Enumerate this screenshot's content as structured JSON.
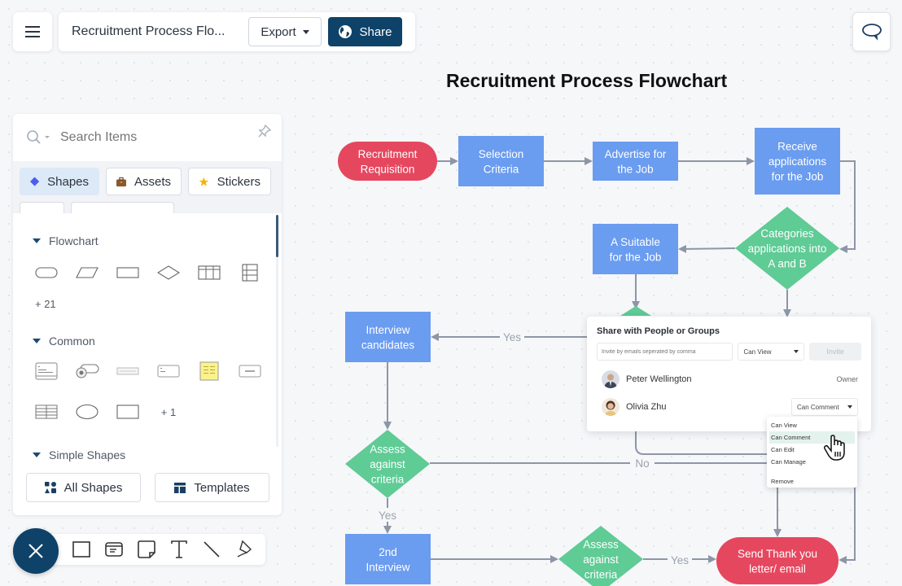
{
  "header": {
    "menu_icon": "hamburger-menu-icon",
    "document_title": "Recruitment Process Flo...",
    "export_label": "Export",
    "share_label": "Share",
    "share_icon": "globe-icon",
    "comment_icon": "speech-bubble-icon",
    "colors": {
      "share_button": "#0e4269"
    }
  },
  "panel": {
    "search_placeholder": "Search Items",
    "pin_icon": "pin-icon",
    "tabs": [
      {
        "label": "Shapes",
        "icon": "diamond-icon",
        "active": true
      },
      {
        "label": "Assets",
        "icon": "briefcase-icon",
        "active": false
      },
      {
        "label": "Stickers",
        "icon": "star-icon",
        "active": false
      }
    ],
    "sections": [
      {
        "title": "Flowchart",
        "more": "+ 21",
        "shapes": [
          "terminator",
          "data-parallelogram",
          "process-rectangle",
          "decision-diamond",
          "swimlane-horizontal",
          "swimlane-vertical"
        ]
      },
      {
        "title": "Common",
        "more": "+ 1",
        "shapes": [
          "form-card",
          "toggle-card",
          "slider-card",
          "input-card",
          "sticky-note",
          "dropdown-card",
          "table",
          "ellipse",
          "rectangle"
        ]
      },
      {
        "title": "Simple Shapes"
      }
    ],
    "all_shapes_label": "All Shapes",
    "templates_label": "Templates"
  },
  "toolbar": {
    "close_icon": "close-icon",
    "tools": [
      "rectangle-tool-icon",
      "text-card-tool-icon",
      "sticky-note-tool-icon",
      "text-tool-icon",
      "line-tool-icon",
      "pen-tool-icon"
    ]
  },
  "canvas": {
    "title": "Recruitment Process Flowchart",
    "colors": {
      "process": "#6a9cf0",
      "decision": "#5fcb95",
      "terminal": "#e5475f",
      "edge": "#8d96a6"
    },
    "nodes": {
      "requisition": [
        "Recruitment",
        "Requisition"
      ],
      "selection": [
        "Selection",
        "Criteria"
      ],
      "advertise": [
        "Advertise for",
        "the Job"
      ],
      "receive": [
        "Receive",
        "applications",
        "for the Job"
      ],
      "categorize": [
        "Categories",
        "applications into",
        "A and B"
      ],
      "suitable": [
        "A Suitable",
        "for the Job"
      ],
      "interview": [
        "Interview",
        "candidates"
      ],
      "assess1": [
        "Assess",
        "against",
        "criteria"
      ],
      "second": [
        "2nd",
        "Interview"
      ],
      "assess2": [
        "Assess",
        "against",
        "criteria"
      ],
      "thankyou": [
        "Send Thank you",
        "letter/  email"
      ]
    },
    "edge_labels": {
      "yes1": "Yes",
      "yes2": "Yes",
      "yes3": "Yes",
      "no": "No"
    }
  },
  "share_dialog": {
    "title": "Share with People or Groups",
    "email_placeholder": "Invite by emails seperated by comma",
    "default_permission": "Can View",
    "invite_label": "Invite",
    "people": [
      {
        "name": "Peter Wellington",
        "role": "Owner"
      },
      {
        "name": "Olivia Zhu",
        "permission": "Can Comment"
      }
    ],
    "permission_options": [
      "Can View",
      "Can Comment",
      "Can Edit",
      "Can Manage",
      "Remove"
    ],
    "selected_option": "Can Comment"
  }
}
